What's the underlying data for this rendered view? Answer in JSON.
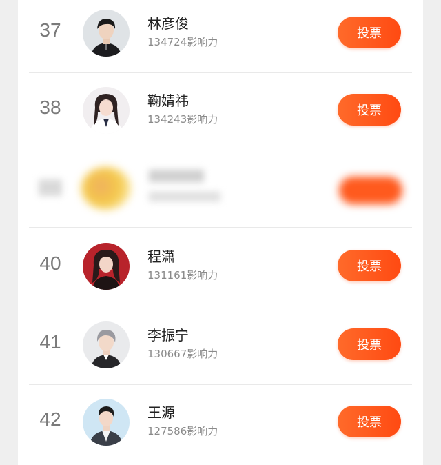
{
  "ranking": {
    "vote_label": "投票",
    "rows": [
      {
        "rank": "37",
        "name": "林彦俊",
        "score": "134724影响力",
        "avatar": "male-dark-outfit"
      },
      {
        "rank": "38",
        "name": "鞠婧祎",
        "score": "134243影响力",
        "avatar": "female-school-uniform"
      },
      {
        "rank": "",
        "name": "",
        "score": "",
        "avatar": "obscured",
        "blurred": true
      },
      {
        "rank": "40",
        "name": "程潇",
        "score": "131161影响力",
        "avatar": "female-red-background"
      },
      {
        "rank": "41",
        "name": "李振宁",
        "score": "130667影响力",
        "avatar": "male-grey-hair"
      },
      {
        "rank": "42",
        "name": "王源",
        "score": "127586影响力",
        "avatar": "male-suit"
      }
    ]
  },
  "colors": {
    "accent": "#ff5a1e",
    "rank_text": "#7a7a7a",
    "score_text": "#8a8a8a",
    "page_background": "#efefef",
    "card_background": "#ffffff"
  }
}
